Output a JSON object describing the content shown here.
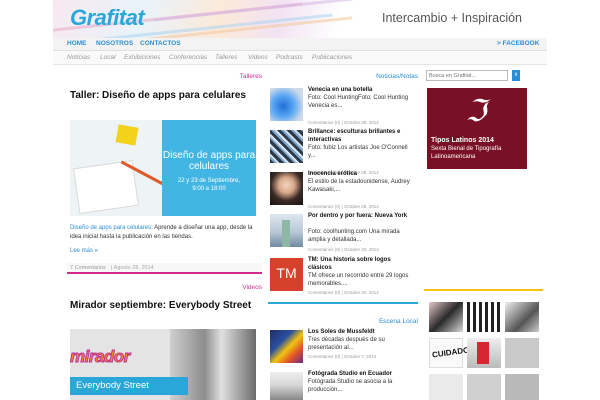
{
  "header": {
    "logo": "Grafitat",
    "tagline": "Intercambio + Inspiración"
  },
  "mainnav": {
    "items": [
      "HOME",
      "NOSOTROS",
      "CONTACTOS"
    ],
    "facebook": "> FACEBOOK"
  },
  "subnav": {
    "items": [
      "Noticias",
      "Local",
      "Exhibiciones",
      "Conferencias",
      "Talleres",
      "Videos",
      "Podcasts",
      "Publicaciones"
    ]
  },
  "left": {
    "post1": {
      "tag": "Talleres",
      "title": "Taller: Diseño de apps para celulares",
      "image": {
        "heading": "Diseño de apps para celulares",
        "dates": "22 y 23 de Septiembre,",
        "time": "9:00 a 18:00"
      },
      "excerpt_link": "Diseño de apps para celulares",
      "excerpt": ": Aprende a diseñar una app, desde la idea inicial hasta la publicación en las tiendas.",
      "more": "Lee más »",
      "comments": "7 Comentarios",
      "date": "| Agosto 28, 2014"
    },
    "post2": {
      "tag": "Videos",
      "title": "Mirador septiembre: Everybody Street",
      "image": {
        "brand": "mirador",
        "subtitle": "Everybody Street"
      }
    }
  },
  "middle": {
    "tag": "Noticias/Notas",
    "items": [
      {
        "title": "Venecia en una botella",
        "excerpt": "Foto: Cool HuntingFoto: Cool Hunting Venecia es...",
        "comments": "Comentarios (0)",
        "date": "| Octubre 28, 2014"
      },
      {
        "title": "Brillance: esculturas brillantes e interactivas",
        "excerpt": "Foto: fubiz Los artistas Joe O'Connell y...",
        "comments": "Comentarios (0)",
        "date": "| Octubre 28, 2014"
      },
      {
        "title": "Inocencia erótica",
        "excerpt": "El estilo de la estadounidense, Audrey Kawasaki,...",
        "comments": "Comentarios (0)",
        "date": "| Octubre 28, 2014"
      },
      {
        "title": "Por dentro y por fuera: Nueva York",
        "excerpt": "Foto: coolhunting.com Una mirada amplia y detallada...",
        "comments": "Comentarios (0)",
        "date": "| Octubre 20, 2014"
      },
      {
        "title": "TM: Una historia sobre logos clásicos",
        "excerpt": "TM ofrece un recorrido entre 29 logos memorables....",
        "comments": "Comentarios (0)",
        "date": "| Octubre 20, 2014",
        "thumb": "TM"
      }
    ],
    "local_tag": "Escena Local",
    "local_items": [
      {
        "title": "Los Soles de Mussfeldt",
        "excerpt": "Tres décadas después de su presentación al...",
        "comments": "Comentarios (0)",
        "date": "| Octubre 7, 2014"
      },
      {
        "title": "Fotógrada Studio en Ecuador",
        "excerpt": "Fotógrada Studio se asocia a la producción...",
        "comments": "",
        "date": ""
      }
    ]
  },
  "right": {
    "search_placeholder": "Busca en Grafitat...",
    "search_button": "Ir",
    "ad": {
      "title": "Tipos Latinos 2014",
      "line2": "Sexta Bienal de Tipografía",
      "line3": "Latinoamericana"
    },
    "gallery_text": "CUIDADO"
  },
  "colors": {
    "accent_pink": "#d22b8f",
    "accent_blue": "#2aa7d9",
    "accent_yellow": "#f2c30f",
    "ad_bg": "#7a1025"
  }
}
